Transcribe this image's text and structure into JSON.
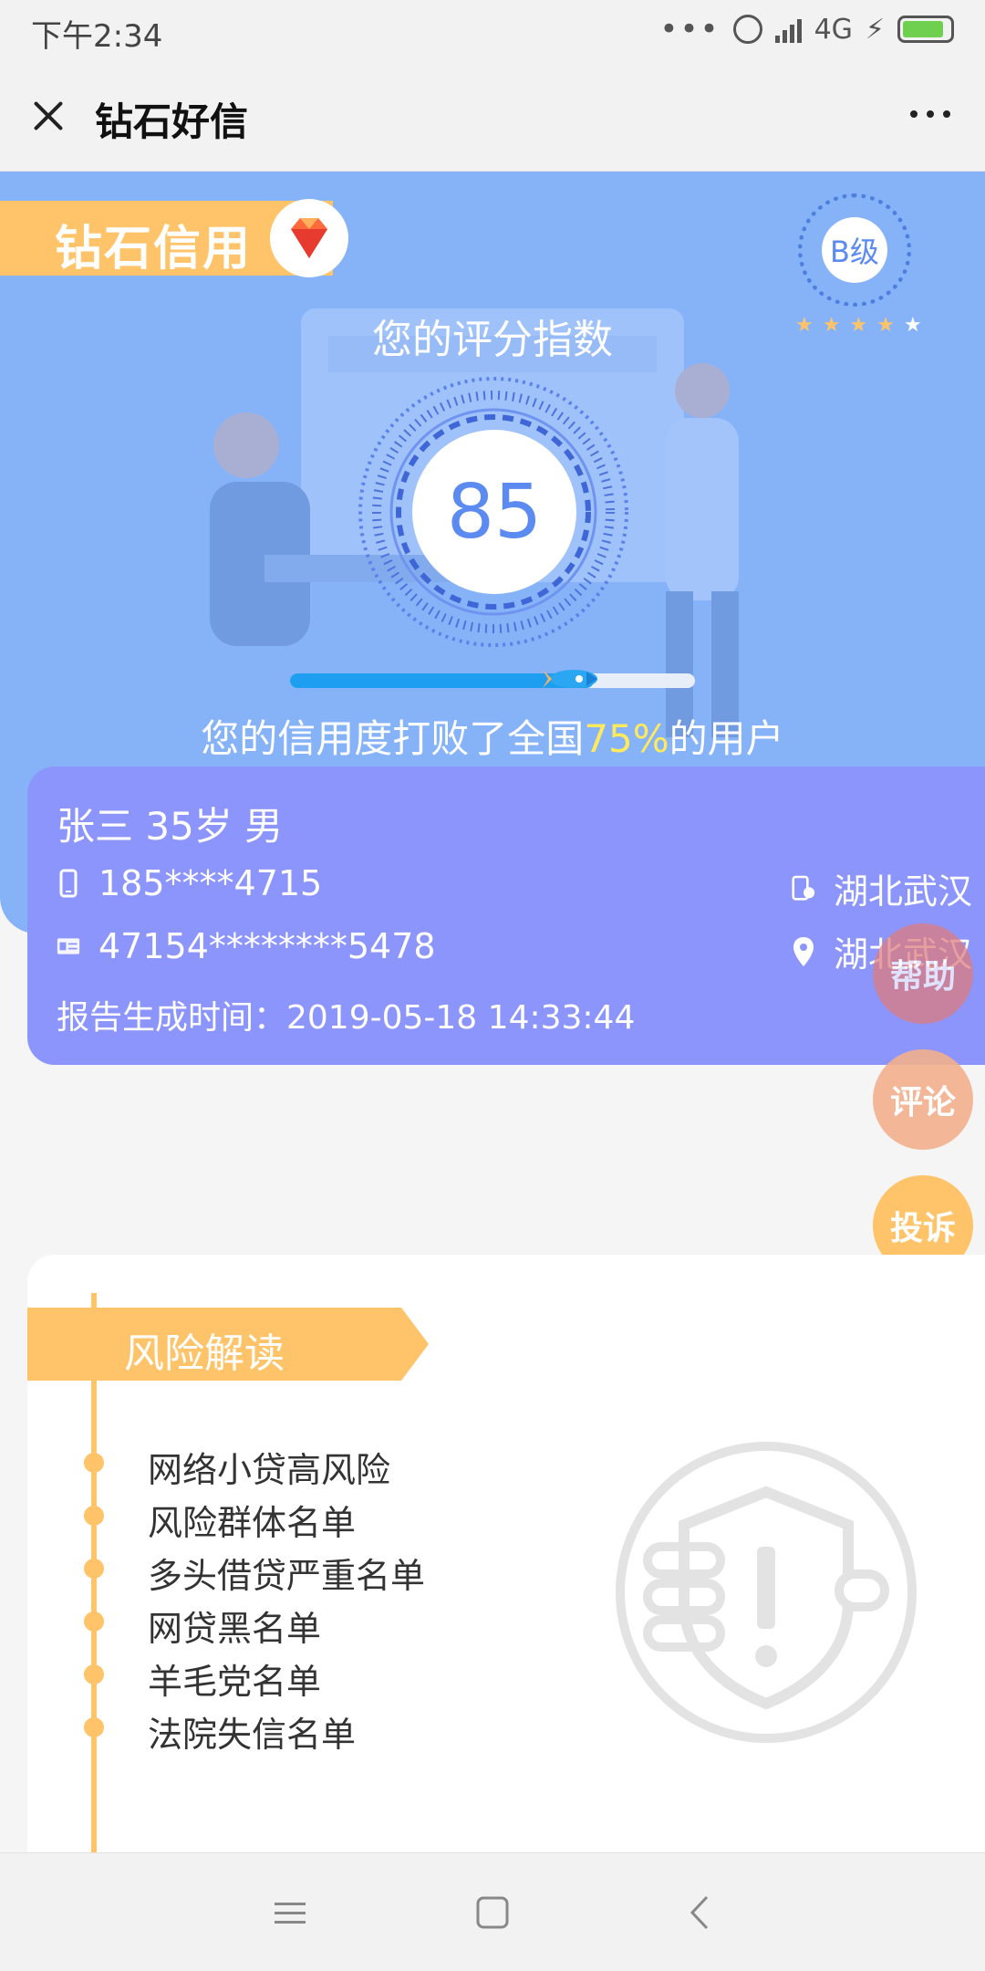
{
  "status_bar": {
    "time": "下午2:34",
    "network": "4G",
    "battery_color": "#6fcf4e"
  },
  "title_bar": {
    "title": "钻石好信",
    "close_icon": "close-icon",
    "more_icon": "more-icon"
  },
  "hero": {
    "background": "#86b3f8",
    "brand": "钻石信用",
    "grade": "B级",
    "stars_total": 5,
    "stars_filled": 4,
    "score_label": "您的评分指数",
    "score": "85",
    "progress": 0.75,
    "beat_prefix": "您的信用度打败了全国",
    "beat_percent": "75%",
    "beat_suffix": "的用户"
  },
  "user": {
    "name_line": "张三  35岁  男",
    "phone": "185****4715",
    "id_number": "47154********5478",
    "phone_location": "湖北武汉",
    "location": "湖北武汉",
    "report_time": "报告生成时间：2019-05-18 14:33:44"
  },
  "floating_buttons": {
    "help": {
      "label": "帮助",
      "color": "#e07b7b"
    },
    "comment": {
      "label": "评论",
      "color": "#f3b08c"
    },
    "complaint": {
      "label": "投诉",
      "color": "#ffc469"
    }
  },
  "risk": {
    "title": "风险解读",
    "accent": "#ffc469",
    "items": [
      "网络小贷高风险",
      "风险群体名单",
      "多头借贷严重名单",
      "网贷黑名单",
      "羊毛党名单",
      "法院失信名单"
    ]
  },
  "nav": {
    "menu_icon": "menu-icon",
    "home_icon": "home-icon",
    "back_icon": "back-icon"
  }
}
